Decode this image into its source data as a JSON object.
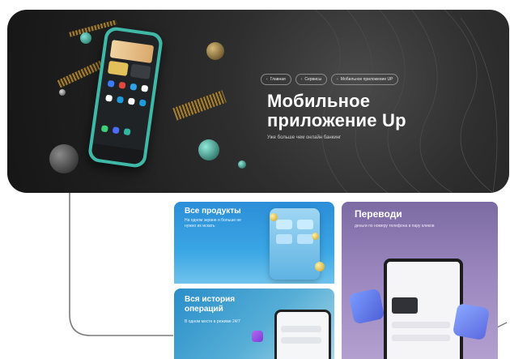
{
  "hero": {
    "breadcrumb": [
      {
        "label": "Главная"
      },
      {
        "label": "Сервисы"
      },
      {
        "label": "Мобильное приложение UP"
      }
    ],
    "title_line1": "Мобильное",
    "title_line2": "приложение Up",
    "subtitle": "Уже больше чем онлайн банкинг"
  },
  "cards": [
    {
      "title": "Все продукты",
      "desc_line1": "На одном экране и больше не",
      "desc_line2": "нужно их искать"
    },
    {
      "title_line1": "Вся история",
      "title_line2": "операций",
      "desc": "В одном месте в режиме 24/7"
    },
    {
      "title": "Переводи",
      "desc": "деньги по номеру телефона в пару кликов"
    }
  ],
  "colors": {
    "hero_bg": "#1f1f1f",
    "phone_frame": "#3fb8a8",
    "card_blue": "#3aa6e4",
    "card_purple": "#9a86bd",
    "gold": "#c9a24a"
  }
}
